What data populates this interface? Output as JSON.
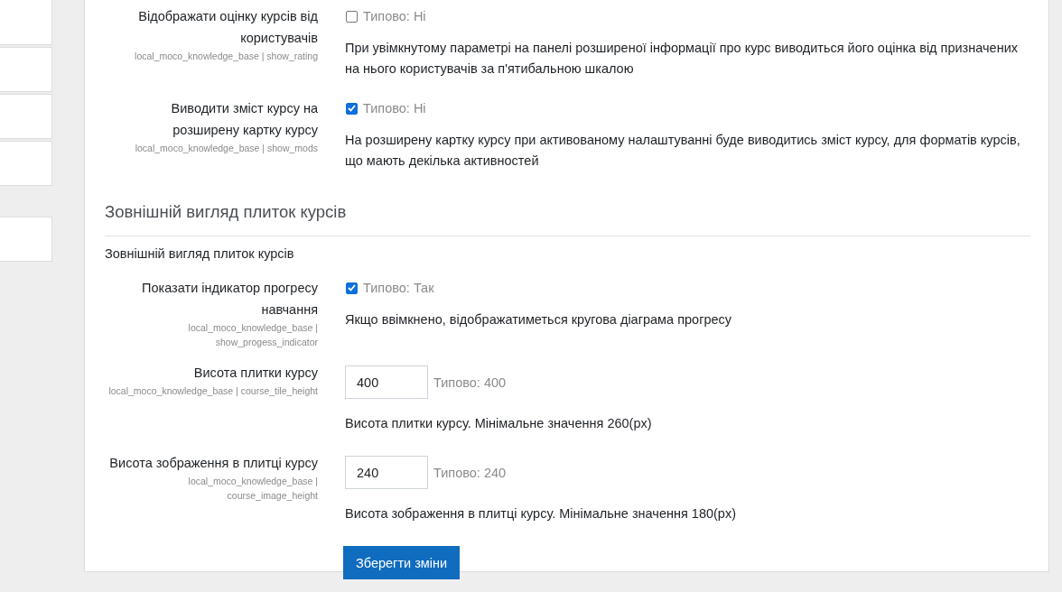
{
  "settings": [
    {
      "kind": "checkbox",
      "label": "Відображати оцінку курсів від користувачів",
      "key": "local_moco_knowledge_base | show_rating",
      "checked": false,
      "default": "Типово: Ні",
      "description": "При увімкнутому параметрі на панелі розширеної інформації про курс виводиться його оцінка від призначених на нього користувачів за п'ятибальною шкалою"
    },
    {
      "kind": "checkbox",
      "label": "Виводити зміст курсу на розширену картку курсу",
      "key": "local_moco_knowledge_base | show_mods",
      "checked": true,
      "default": "Типово: Ні",
      "description": "На розширену картку курсу при активованому налаштуванні буде виводитись зміст курсу, для форматів курсів, що мають декілька активностей"
    }
  ],
  "section": {
    "heading": "Зовнішній вигляд плиток курсів",
    "subheading": "Зовнішній вигляд плиток курсів",
    "settings": [
      {
        "kind": "checkbox",
        "label": "Показати індикатор прогресу навчання",
        "key": "local_moco_knowledge_base | show_progess_indicator",
        "checked": true,
        "default": "Типово: Так",
        "description": "Якщо ввімкнено, відображатиметься кругова діаграма прогресу"
      },
      {
        "kind": "text",
        "label": "Висота плитки курсу",
        "key": "local_moco_knowledge_base | course_tile_height",
        "value": "400",
        "default": "Типово: 400",
        "description": "Висота плитки курсу. Мінімальне значення 260(px)"
      },
      {
        "kind": "text",
        "label": "Висота зображення в плитці курсу",
        "key": "local_moco_knowledge_base | course_image_height",
        "value": "240",
        "default": "Типово: 240",
        "description": "Висота зображення в плитці курсу. Мінімальне значення 180(px)"
      }
    ]
  },
  "save_button": "Зберегти зміни"
}
